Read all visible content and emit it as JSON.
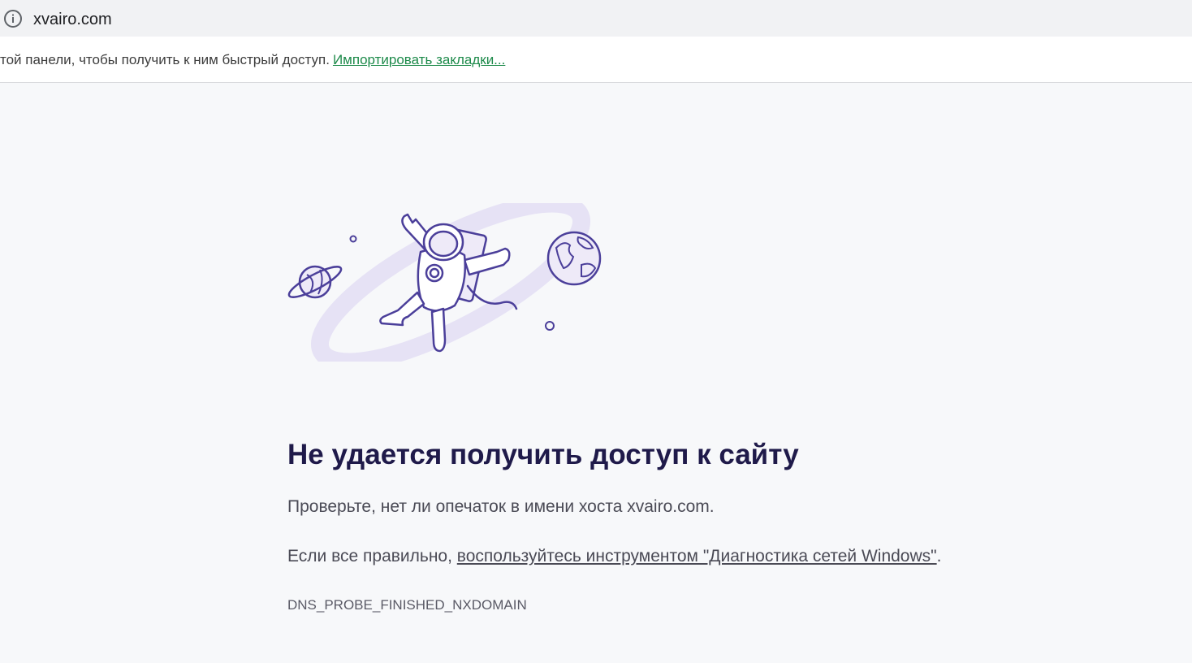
{
  "address_bar": {
    "url": "xvairo.com",
    "info_icon": "info-circle-icon"
  },
  "bookmarks_bar": {
    "text": "той панели, чтобы получить к ним быстрый доступ.",
    "import_link": "Импортировать закладки..."
  },
  "error_page": {
    "illustration": "astronaut-in-space-illustration",
    "title": "Не удается получить доступ к сайту",
    "message": "Проверьте, нет ли опечаток в имени хоста xvairo.com.",
    "diagnostics_prefix": "Если все правильно, ",
    "diagnostics_link": "воспользуйтесь инструментом \"Диагностика сетей Windows\"",
    "diagnostics_suffix": ".",
    "error_code": "DNS_PROBE_FINISHED_NXDOMAIN"
  },
  "colors": {
    "accent_link": "#1d8a4a",
    "title": "#1f1a4a",
    "illustration_stroke": "#4b3f9a",
    "illustration_fill": "#e6e2f5"
  }
}
